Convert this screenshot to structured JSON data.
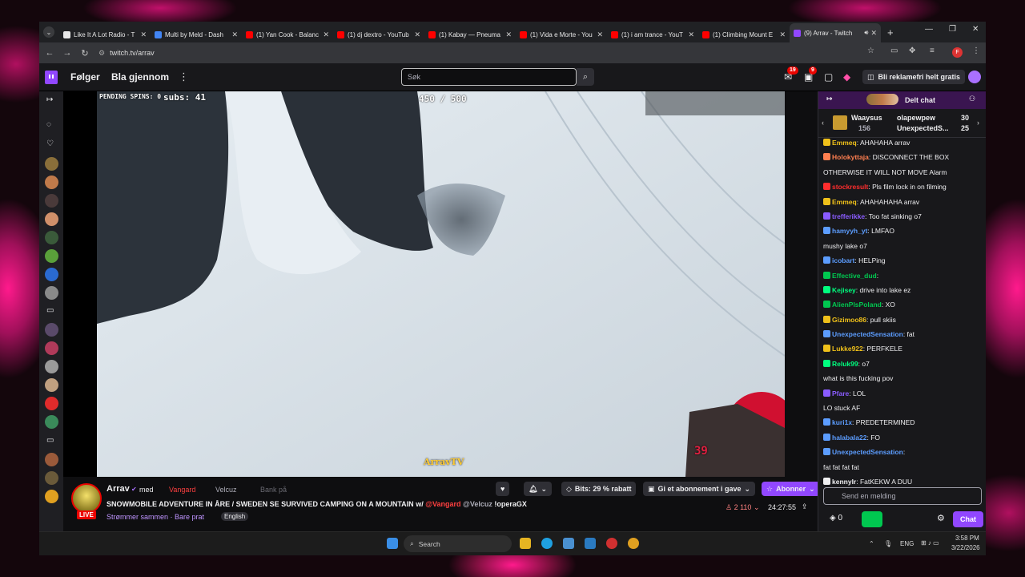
{
  "browser": {
    "tabs": [
      {
        "label": "Like It A Lot Radio - T",
        "icon_color": "#e8e8e8"
      },
      {
        "label": "Multi by Meld - Dash",
        "icon_color": "#4285f4"
      },
      {
        "label": "(1) Yan Cook - Balanc",
        "icon_color": "#ff0000"
      },
      {
        "label": "(1) dj dextro - YouTub",
        "icon_color": "#ff0000"
      },
      {
        "label": "(1) Kabay — Pneuma",
        "icon_color": "#ff0000"
      },
      {
        "label": "(1) Vida e Morte - You",
        "icon_color": "#ff0000"
      },
      {
        "label": "(1) i am trance - YouT",
        "icon_color": "#ff0000"
      },
      {
        "label": "(1) Climbing Mount E",
        "icon_color": "#ff0000"
      },
      {
        "label": "(9) Arrav - Twitch",
        "icon_color": "#9147ff",
        "active": true
      }
    ],
    "url": "twitch.tv/arrav",
    "profile_initial": "F"
  },
  "twitch": {
    "nav_following": "Følger",
    "nav_browse": "Bla gjennom",
    "search_placeholder": "Søk",
    "badge_inbox": "19",
    "badge_notif": "9",
    "ad_free": "Bli reklamefri helt gratis"
  },
  "video": {
    "pending_spins": "PENDING SPINS: 0",
    "subs": "subs: 41",
    "counter": "450 / 500",
    "channel_tag": "ArravTV",
    "cam_number": "39"
  },
  "stream": {
    "name": "Arrav",
    "with": "med",
    "collab1": "Vangard",
    "collab2": "Velcuz",
    "bank": "Bank på",
    "live": "LIVE",
    "title": "SNOWMOBILE ADVENTURE IN ÅRE / SWEDEN SE SURVIVED CAMPING ON A MOUNTAIN",
    "title_with": "w/",
    "title_v1": "@Vangard",
    "title_v2": "@Velcuz",
    "title_tail": "!operaGX",
    "category": "Strømmer sammen · Bare prat",
    "language": "English",
    "bits": "Bits: 29 % rabatt",
    "gift": "Gi et abonnement i gave",
    "subscribe": "Abonner",
    "viewers": "2 110",
    "uptime": "24:27:55"
  },
  "chat": {
    "header": "Delt chat",
    "gifts": [
      {
        "name": "Waaysus",
        "count": "156"
      },
      {
        "name": "olapewpew",
        "count": "30"
      },
      {
        "name": "UnexpectedS...",
        "count": "25"
      }
    ],
    "messages": [
      {
        "user": "Emmeq",
        "color": "#efc01a",
        "text": "AHAHAHA arrav"
      },
      {
        "user": "Holokyttaja",
        "color": "#ff7f50",
        "text": "DISCONNECT THE BOX"
      },
      {
        "user": "",
        "color": "#efeff1",
        "text": "OTHERWISE IT WILL NOT MOVE Alarm"
      },
      {
        "user": "stockresult",
        "color": "#ff2d2d",
        "text": "Pls film lock in on filming"
      },
      {
        "user": "Emmeq",
        "color": "#efc01a",
        "text": "AHAHAHAHA arrav"
      },
      {
        "user": "trefferikke",
        "color": "#8a5cff",
        "text": "Too fat sinking o7"
      },
      {
        "user": "hamyyh_yt",
        "color": "#5c9dff",
        "text": "LMFAO"
      },
      {
        "user": "",
        "color": "#4b4bff",
        "text": "mushy lake o7"
      },
      {
        "user": "icobart",
        "color": "#5c9dff",
        "text": "HELPing"
      },
      {
        "user": "Effective_dud",
        "color": "#00c850",
        "text": ""
      },
      {
        "user": "Kejisey",
        "color": "#00ff7f",
        "text": "drive into lake ez"
      },
      {
        "user": "AlienPlsPoland",
        "color": "#00c850",
        "text": "XO"
      },
      {
        "user": "Gizimoo86",
        "color": "#efc01a",
        "text": "pull skiis"
      },
      {
        "user": "UnexpectedSensation",
        "color": "#5c9dff",
        "text": "fat"
      },
      {
        "user": "Lukke922",
        "color": "#efc01a",
        "text": "PERFKELE"
      },
      {
        "user": "Reluk99",
        "color": "#00ff7f",
        "text": "o7"
      },
      {
        "user": "",
        "color": "#ff2d2d",
        "text": "what is this fucking pov"
      },
      {
        "user": "Pfare",
        "color": "#8a5cff",
        "text": "LOL"
      },
      {
        "user": "",
        "color": "#ff2d2d",
        "text": "LO stuck AF"
      },
      {
        "user": "kuri1x",
        "color": "#5c9dff",
        "text": "PREDETERMINED"
      },
      {
        "user": "halabala22",
        "color": "#5c9dff",
        "text": "FO"
      },
      {
        "user": "UnexpectedSensation",
        "color": "#5c9dff",
        "text": ""
      },
      {
        "user": "",
        "color": "#efeff1",
        "text": "fat fat fat fat"
      },
      {
        "user": "kennylr",
        "color": "#efeff1",
        "text": "FatKEKW A DUU"
      }
    ],
    "input_placeholder": "Send en melding",
    "points": "0",
    "chat_button": "Chat"
  },
  "taskbar": {
    "search": "Search",
    "lang": "ENG",
    "time": "3:58 PM",
    "date": "3/22/2026"
  }
}
